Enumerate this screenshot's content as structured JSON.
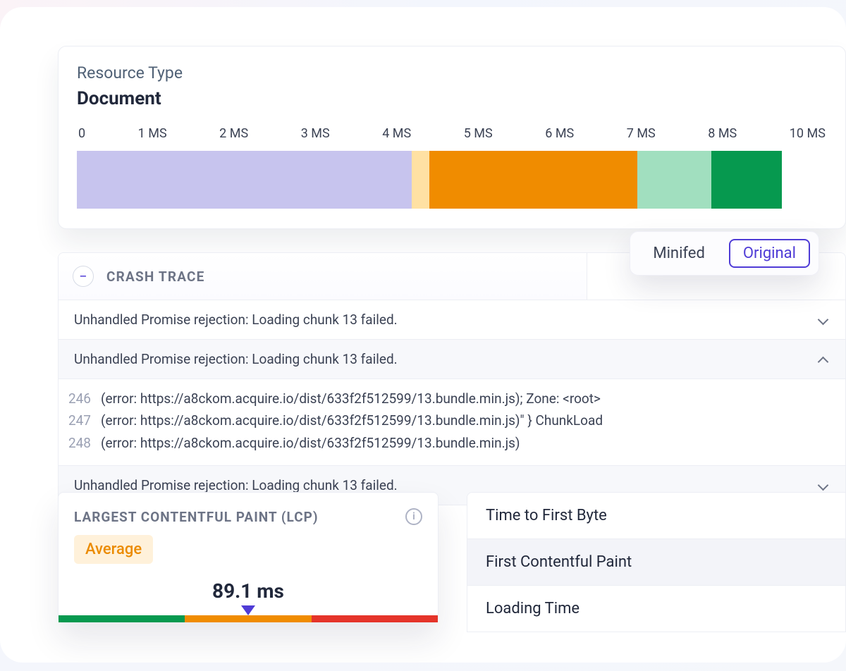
{
  "resource": {
    "label": "Resource Type",
    "value": "Document",
    "ticks": [
      "0",
      "1 MS",
      "2 MS",
      "3 MS",
      "4 MS",
      "5 MS",
      "6 MS",
      "7 MS",
      "8 MS",
      "10 MS"
    ],
    "segments": [
      {
        "cls": "seg-lavender",
        "pct": 47.5
      },
      {
        "cls": "seg-cream",
        "pct": 2.5
      },
      {
        "cls": "seg-orange",
        "pct": 29.5
      },
      {
        "cls": "seg-mint",
        "pct": 10.5
      },
      {
        "cls": "seg-green",
        "pct": 10.0
      }
    ]
  },
  "toggle": {
    "minified": "Minifed",
    "original": "Original"
  },
  "crash": {
    "title": "CRASH TRACE",
    "row1": "Unhandled Promise rejection: Loading chunk 13 failed.",
    "row2": "Unhandled Promise rejection: Loading chunk 13 failed.",
    "row3": "Unhandled Promise rejection: Loading chunk 13 failed.",
    "lines": [
      {
        "n": "246",
        "t": "(error: https://a8ckom.acquire.io/dist/633f2f512599/13.bundle.min.js); Zone: <root>"
      },
      {
        "n": "247",
        "t": "(error: https://a8ckom.acquire.io/dist/633f2f512599/13.bundle.min.js)\" } ChunkLoad"
      },
      {
        "n": "248",
        "t": "(error: https://a8ckom.acquire.io/dist/633f2f512599/13.bundle.min.js)"
      }
    ]
  },
  "lcp": {
    "title": "LARGEST CONTENTFUL PAINT (LCP)",
    "badge": "Average",
    "value": "89.1 ms"
  },
  "metrics": {
    "ttfb": "Time to First Byte",
    "fcp": "First Contentful Paint",
    "load": "Loading Time"
  }
}
